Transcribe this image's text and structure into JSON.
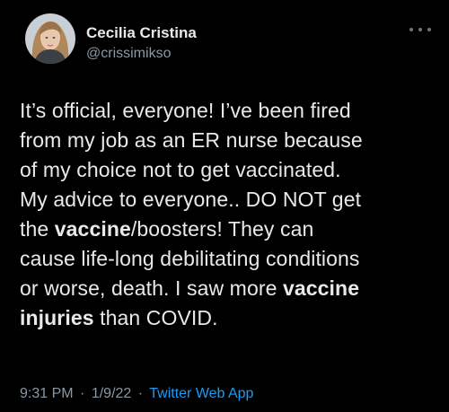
{
  "author": {
    "display_name": "Cecilia Cristina",
    "handle": "@crissimikso",
    "avatar_icon": "user-avatar-photo"
  },
  "more_icon": "more-horizontal-icon",
  "tweet": {
    "lines": [
      [
        {
          "t": "It’s official, everyone! I’ve been fired"
        }
      ],
      [
        {
          "t": "from my job as an ER nurse because"
        }
      ],
      [
        {
          "t": "of my choice not to get vaccinated."
        }
      ],
      [
        {
          "t": "My advice to everyone.. DO NOT get"
        }
      ],
      [
        {
          "t": "the "
        },
        {
          "t": "vaccine",
          "b": true
        },
        {
          "t": "/boosters! They can"
        }
      ],
      [
        {
          "t": "cause life-long debilitating conditions"
        }
      ],
      [
        {
          "t": "or worse, death. I saw more "
        },
        {
          "t": "vaccine",
          "b": true
        }
      ],
      [
        {
          "t": "injuries",
          "b": true
        },
        {
          "t": " than COVID."
        }
      ]
    ]
  },
  "meta": {
    "time": "9:31 PM",
    "separator": "·",
    "date": "1/9/22",
    "app": "Twitter Web App"
  },
  "colors": {
    "background": "#000000",
    "text": "#e7e9ea",
    "secondary": "#8b98a5",
    "link": "#1d9bf0"
  }
}
